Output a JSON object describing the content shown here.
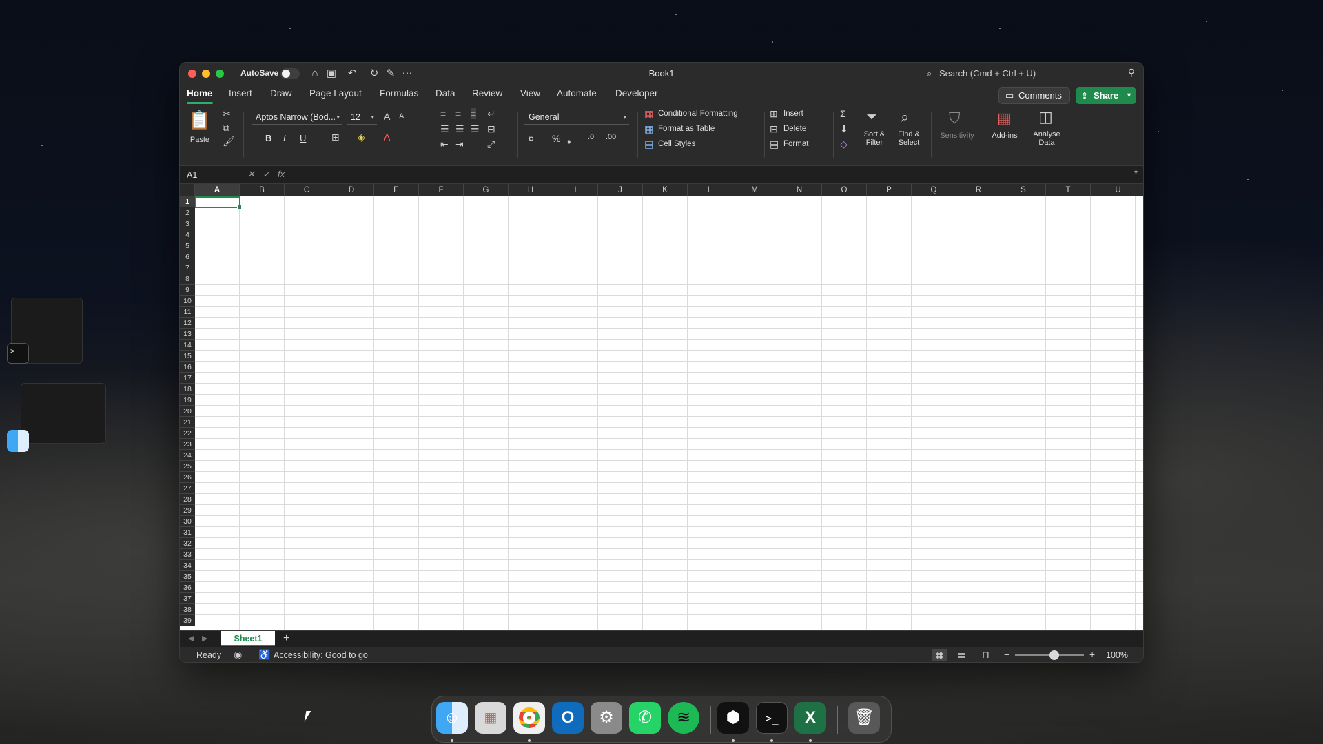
{
  "window": {
    "title": "Book1",
    "autosave_label": "AutoSave",
    "search_placeholder": "Search (Cmd + Ctrl + U)"
  },
  "tabs": [
    "Home",
    "Insert",
    "Draw",
    "Page Layout",
    "Formulas",
    "Data",
    "Review",
    "View",
    "Automate",
    "Developer"
  ],
  "active_tab": "Home",
  "buttons": {
    "comments": "Comments",
    "share": "Share"
  },
  "ribbon": {
    "paste": "Paste",
    "font_name": "Aptos Narrow (Bod...",
    "font_size": "12",
    "number_format": "General",
    "conditional_formatting": "Conditional Formatting",
    "format_as_table": "Format as Table",
    "cell_styles": "Cell Styles",
    "insert": "Insert",
    "delete": "Delete",
    "format": "Format",
    "sort_filter": "Sort & Filter",
    "find_select": "Find & Select",
    "sensitivity": "Sensitivity",
    "add_ins": "Add-ins",
    "analyse_data": "Analyse Data",
    "bold": "B",
    "italic": "I",
    "underline": "U"
  },
  "formula_bar": {
    "name_box": "A1",
    "fx": "fx",
    "value": ""
  },
  "columns": [
    "A",
    "B",
    "C",
    "D",
    "E",
    "F",
    "G",
    "H",
    "I",
    "J",
    "K",
    "L",
    "M",
    "N",
    "O",
    "P",
    "Q",
    "R",
    "S",
    "T",
    "U"
  ],
  "rows": [
    "1",
    "2",
    "3",
    "4",
    "5",
    "6",
    "7",
    "8",
    "9",
    "10",
    "11",
    "12",
    "13",
    "14",
    "15",
    "16",
    "17",
    "18",
    "19",
    "20",
    "21",
    "22",
    "23",
    "24",
    "25",
    "26",
    "27",
    "28",
    "29",
    "30",
    "31",
    "32",
    "33",
    "34",
    "35",
    "36",
    "37",
    "38",
    "39"
  ],
  "selected_cell": "A1",
  "sheets": [
    "Sheet1"
  ],
  "status": {
    "ready": "Ready",
    "accessibility": "Accessibility: Good to go",
    "zoom": "100%"
  },
  "dock_apps": [
    "Finder",
    "Launchpad",
    "Google Chrome",
    "Microsoft Outlook",
    "System Settings",
    "WhatsApp",
    "Spotify",
    "Unity Hub",
    "Terminal",
    "Microsoft Excel",
    "Trash"
  ],
  "colors": {
    "accent": "#1e8a4c",
    "window_bg": "#1f1f1f",
    "chrome_bg": "#2b2b2b"
  }
}
